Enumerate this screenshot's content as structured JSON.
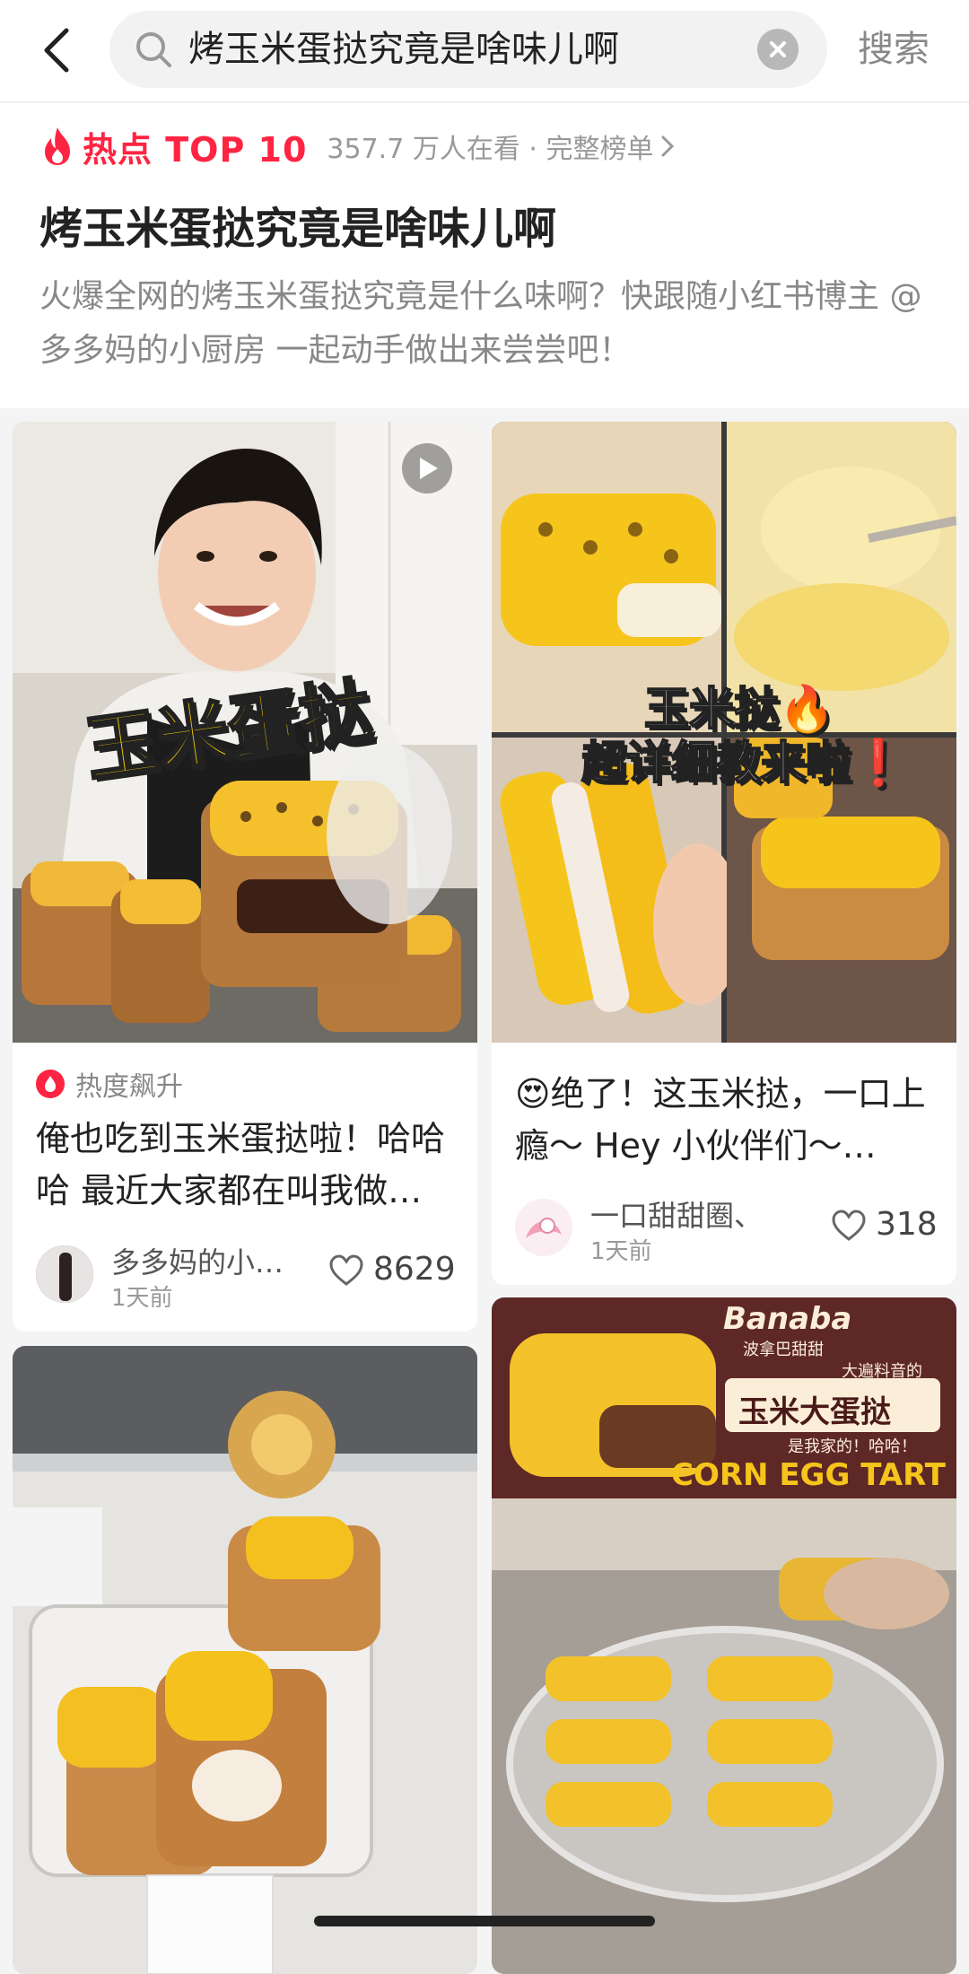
{
  "search": {
    "query": "烤玉米蛋挞究竟是啥味儿啊",
    "button_label": "搜索"
  },
  "hot_topic": {
    "badge": "热点 TOP 10",
    "viewers": "357.7 万人在看 · 完整榜单",
    "title": "烤玉米蛋挞究竟是啥味儿啊",
    "description": "火爆全网的烤玉米蛋挞究竟是什么味啊？快跟随小红书博主 @ 多多妈的小厨房 一起动手做出来尝尝吧！"
  },
  "posts": [
    {
      "image_caption": "玉米蛋挞",
      "tag": "热度飙升",
      "title": "俺也吃到玉米蛋挞啦！哈哈哈 最近大家都在叫我做…",
      "author": "多多妈的小…",
      "time": "1天前",
      "likes": "8629"
    },
    {
      "image_caption_line1": "玉米挞🔥",
      "image_caption_line2": "超详细教来啦❗",
      "title": "😍绝了！这玉米挞，一口上瘾～ Hey 小伙伴们～…",
      "author": "一口甜甜圈、",
      "time": "1天前",
      "likes": "318"
    },
    {
      "image_caption": ""
    },
    {
      "sign_brand": "Banaba",
      "sign_brand_sub": "波拿巴甜甜",
      "sign_side": "大遍料音的",
      "sign_title": "玉米大蛋挞",
      "sign_note": "是我家的！哈哈！",
      "sign_english": "CORN EGG TART"
    }
  ]
}
